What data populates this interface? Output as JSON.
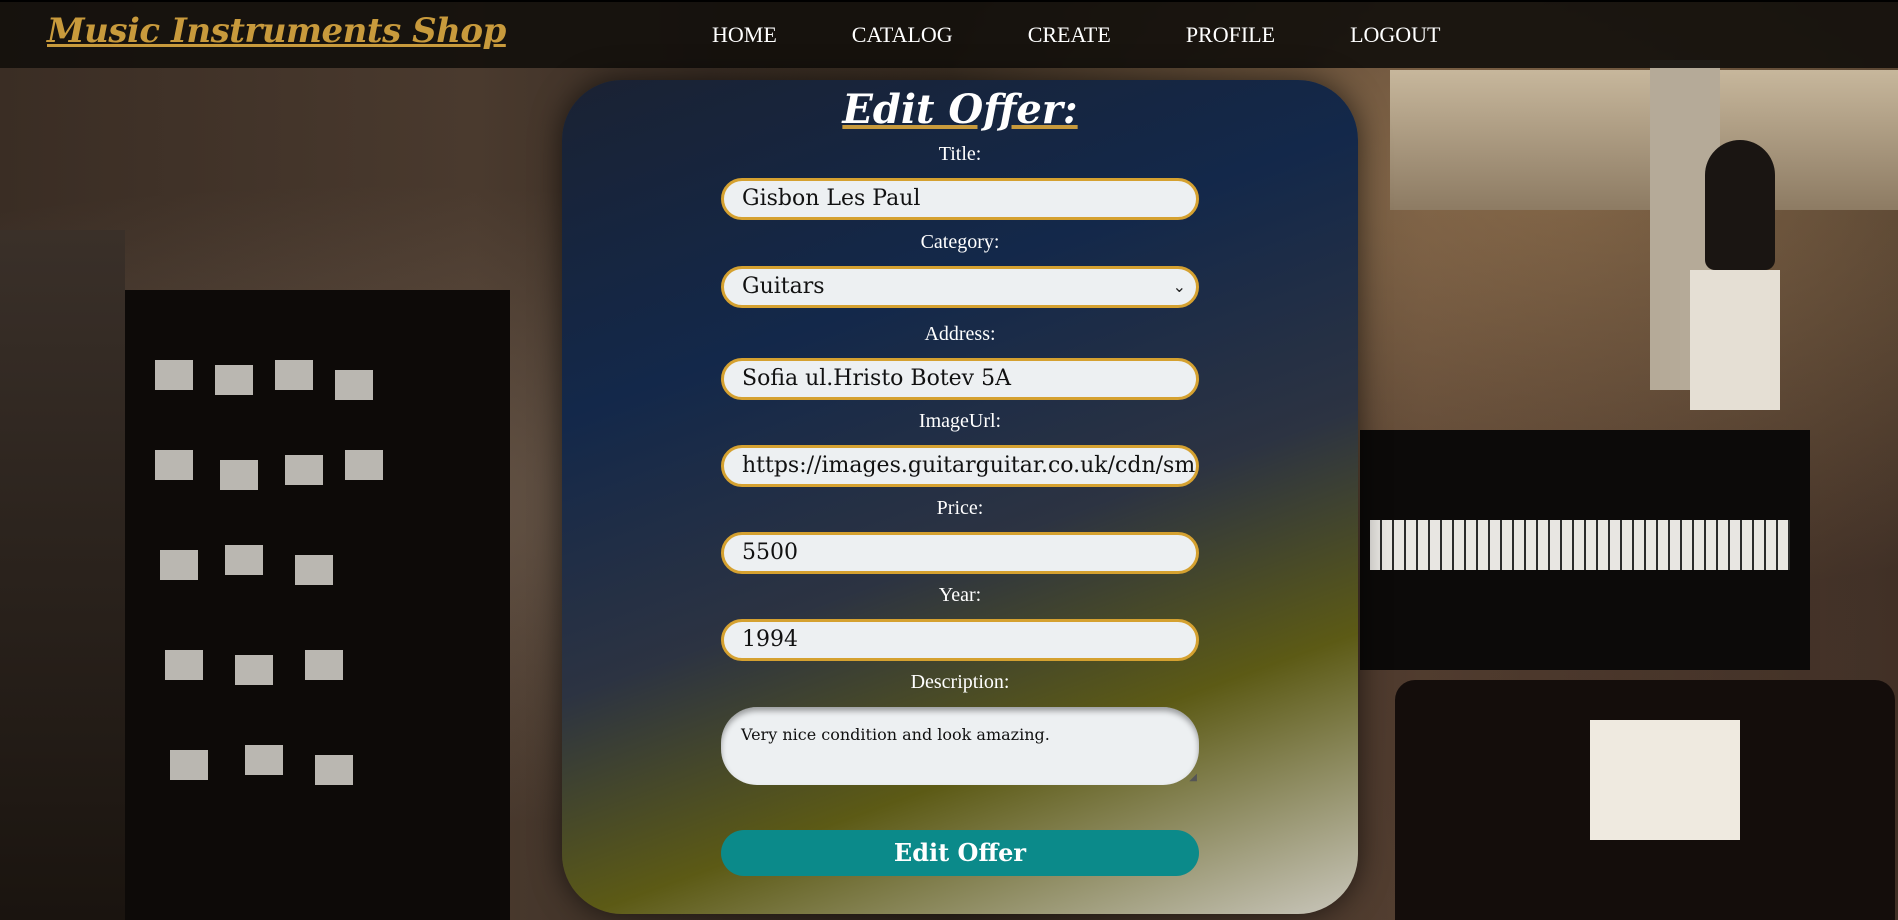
{
  "header": {
    "brand": "Music Instruments Shop",
    "nav": [
      "HOME",
      "CATALOG",
      "CREATE",
      "PROFILE",
      "LOGOUT"
    ]
  },
  "form": {
    "heading": "Edit Offer:",
    "title_label": "Title:",
    "title_value": "Gisbon Les Paul",
    "category_label": "Category:",
    "category_value": "Guitars",
    "address_label": "Address:",
    "address_value": "Sofia ul.Hristo Botev 5A",
    "image_label": "ImageUrl:",
    "image_value": "https://images.guitarguitar.co.uk/cdn/smal",
    "price_label": "Price:",
    "price_value": "5500",
    "year_label": "Year:",
    "year_value": "1994",
    "description_label": "Description:",
    "description_value": "Very nice condition and look amazing.",
    "submit_label": "Edit Offer"
  },
  "colors": {
    "brand": "#c89a3c",
    "field_border": "#d5a130",
    "submit_bg": "#0b8a8a"
  },
  "icons": {
    "select": "chevron-down-icon"
  }
}
